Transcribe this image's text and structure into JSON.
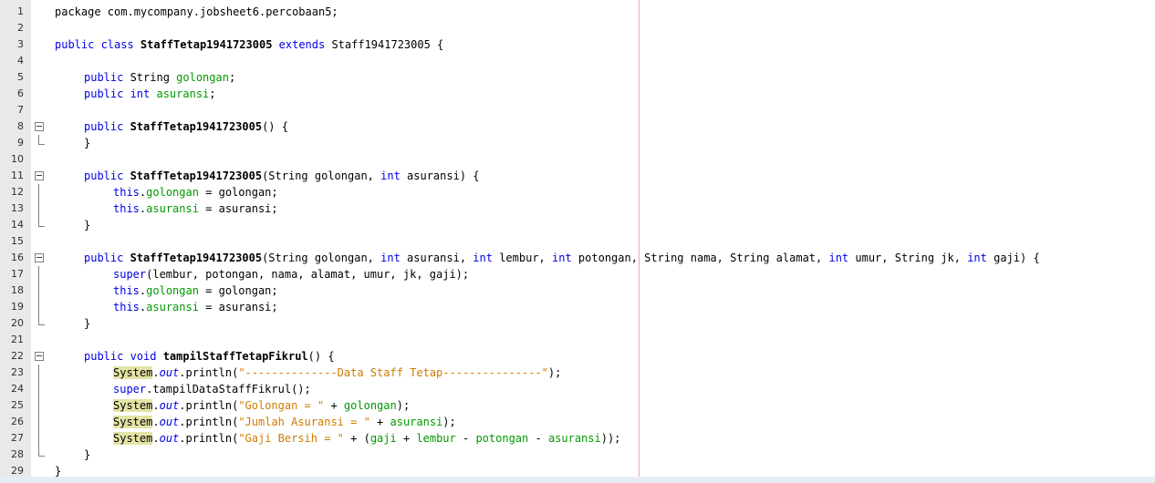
{
  "editor": {
    "accent_colors": {
      "keyword": "#0000e6",
      "field": "#009900",
      "string": "#ce7b00",
      "highlight": "#e4e4a6",
      "margin_line": "#f2a8a8",
      "gutter": "#e9e9ec"
    },
    "lines": [
      {
        "no": "1",
        "indent": 0,
        "tokens": [
          {
            "t": "package com.mycompany.jobsheet6.percobaan5;"
          }
        ]
      },
      {
        "no": "2",
        "indent": 0,
        "tokens": []
      },
      {
        "no": "3",
        "indent": 0,
        "tokens": [
          {
            "t": "public class ",
            "c": "kw"
          },
          {
            "t": "StaffTetap1941723005",
            "c": "bold"
          },
          {
            "t": " extends ",
            "c": "kw"
          },
          {
            "t": "Staff1941723005 {"
          }
        ]
      },
      {
        "no": "4",
        "indent": 0,
        "tokens": []
      },
      {
        "no": "5",
        "indent": 1,
        "tokens": [
          {
            "t": "public ",
            "c": "kw"
          },
          {
            "t": "String "
          },
          {
            "t": "golongan",
            "c": "field"
          },
          {
            "t": ";"
          }
        ]
      },
      {
        "no": "6",
        "indent": 1,
        "tokens": [
          {
            "t": "public int ",
            "c": "kw"
          },
          {
            "t": "asuransi",
            "c": "field"
          },
          {
            "t": ";"
          }
        ]
      },
      {
        "no": "7",
        "indent": 0,
        "tokens": []
      },
      {
        "no": "8",
        "indent": 1,
        "fold": "start",
        "tokens": [
          {
            "t": "public ",
            "c": "kw"
          },
          {
            "t": "StaffTetap1941723005",
            "c": "bold"
          },
          {
            "t": "() {"
          }
        ]
      },
      {
        "no": "9",
        "indent": 1,
        "fold": "end",
        "tokens": [
          {
            "t": "}"
          }
        ]
      },
      {
        "no": "10",
        "indent": 0,
        "tokens": []
      },
      {
        "no": "11",
        "indent": 1,
        "fold": "start",
        "tokens": [
          {
            "t": "public ",
            "c": "kw"
          },
          {
            "t": "StaffTetap1941723005",
            "c": "bold"
          },
          {
            "t": "(String golongan, "
          },
          {
            "t": "int",
            "c": "kw"
          },
          {
            "t": " asuransi) {"
          }
        ]
      },
      {
        "no": "12",
        "indent": 2,
        "fold": "mid",
        "tokens": [
          {
            "t": "this",
            "c": "kw"
          },
          {
            "t": "."
          },
          {
            "t": "golongan",
            "c": "field"
          },
          {
            "t": " = golongan;"
          }
        ]
      },
      {
        "no": "13",
        "indent": 2,
        "fold": "mid",
        "tokens": [
          {
            "t": "this",
            "c": "kw"
          },
          {
            "t": "."
          },
          {
            "t": "asuransi",
            "c": "field"
          },
          {
            "t": " = asuransi;"
          }
        ]
      },
      {
        "no": "14",
        "indent": 1,
        "fold": "end",
        "tokens": [
          {
            "t": "}"
          }
        ]
      },
      {
        "no": "15",
        "indent": 0,
        "tokens": []
      },
      {
        "no": "16",
        "indent": 1,
        "fold": "start",
        "tokens": [
          {
            "t": "public ",
            "c": "kw"
          },
          {
            "t": "StaffTetap1941723005",
            "c": "bold"
          },
          {
            "t": "(String golongan, "
          },
          {
            "t": "int",
            "c": "kw"
          },
          {
            "t": " asuransi, "
          },
          {
            "t": "int",
            "c": "kw"
          },
          {
            "t": " lembur, "
          },
          {
            "t": "int",
            "c": "kw"
          },
          {
            "t": " potongan, String nama, String alamat, "
          },
          {
            "t": "int",
            "c": "kw"
          },
          {
            "t": " umur, String jk, "
          },
          {
            "t": "int",
            "c": "kw"
          },
          {
            "t": " gaji) {"
          }
        ]
      },
      {
        "no": "17",
        "indent": 2,
        "fold": "mid",
        "tokens": [
          {
            "t": "super",
            "c": "kw"
          },
          {
            "t": "(lembur, potongan, nama, alamat, umur, jk, gaji);"
          }
        ]
      },
      {
        "no": "18",
        "indent": 2,
        "fold": "mid",
        "tokens": [
          {
            "t": "this",
            "c": "kw"
          },
          {
            "t": "."
          },
          {
            "t": "golongan",
            "c": "field"
          },
          {
            "t": " = golongan;"
          }
        ]
      },
      {
        "no": "19",
        "indent": 2,
        "fold": "mid",
        "tokens": [
          {
            "t": "this",
            "c": "kw"
          },
          {
            "t": "."
          },
          {
            "t": "asuransi",
            "c": "field"
          },
          {
            "t": " = asuransi;"
          }
        ]
      },
      {
        "no": "20",
        "indent": 1,
        "fold": "end",
        "tokens": [
          {
            "t": "}"
          }
        ]
      },
      {
        "no": "21",
        "indent": 0,
        "tokens": []
      },
      {
        "no": "22",
        "indent": 1,
        "fold": "start",
        "tokens": [
          {
            "t": "public void ",
            "c": "kw"
          },
          {
            "t": "tampilStaffTetapFikrul",
            "c": "bold"
          },
          {
            "t": "() {"
          }
        ]
      },
      {
        "no": "23",
        "indent": 2,
        "fold": "mid",
        "tokens": [
          {
            "t": "System",
            "c": "hl"
          },
          {
            "t": "."
          },
          {
            "t": "out",
            "c": "kw ital"
          },
          {
            "t": ".println("
          },
          {
            "t": "\"--------------Data Staff Tetap---------------\"",
            "c": "str"
          },
          {
            "t": ");"
          }
        ]
      },
      {
        "no": "24",
        "indent": 2,
        "fold": "mid",
        "tokens": [
          {
            "t": "super",
            "c": "kw"
          },
          {
            "t": ".tampilDataStaffFikrul();"
          }
        ]
      },
      {
        "no": "25",
        "indent": 2,
        "fold": "mid",
        "tokens": [
          {
            "t": "System",
            "c": "hl"
          },
          {
            "t": "."
          },
          {
            "t": "out",
            "c": "kw ital"
          },
          {
            "t": ".println("
          },
          {
            "t": "\"Golongan = \"",
            "c": "str"
          },
          {
            "t": " + "
          },
          {
            "t": "golongan",
            "c": "field"
          },
          {
            "t": ");"
          }
        ]
      },
      {
        "no": "26",
        "indent": 2,
        "fold": "mid",
        "tokens": [
          {
            "t": "System",
            "c": "hl"
          },
          {
            "t": "."
          },
          {
            "t": "out",
            "c": "kw ital"
          },
          {
            "t": ".println("
          },
          {
            "t": "\"Jumlah Asuransi = \"",
            "c": "str"
          },
          {
            "t": " + "
          },
          {
            "t": "asuransi",
            "c": "field"
          },
          {
            "t": ");"
          }
        ]
      },
      {
        "no": "27",
        "indent": 2,
        "fold": "mid",
        "tokens": [
          {
            "t": "System",
            "c": "hl"
          },
          {
            "t": "."
          },
          {
            "t": "out",
            "c": "kw ital"
          },
          {
            "t": ".println("
          },
          {
            "t": "\"Gaji Bersih = \"",
            "c": "str"
          },
          {
            "t": " + ("
          },
          {
            "t": "gaji",
            "c": "field"
          },
          {
            "t": " + "
          },
          {
            "t": "lembur",
            "c": "field"
          },
          {
            "t": " - "
          },
          {
            "t": "potongan",
            "c": "field"
          },
          {
            "t": " - "
          },
          {
            "t": "asuransi",
            "c": "field"
          },
          {
            "t": "));"
          }
        ]
      },
      {
        "no": "28",
        "indent": 1,
        "fold": "end",
        "tokens": [
          {
            "t": "}"
          }
        ]
      },
      {
        "no": "29",
        "indent": 0,
        "tokens": [
          {
            "t": "}"
          }
        ]
      }
    ]
  }
}
